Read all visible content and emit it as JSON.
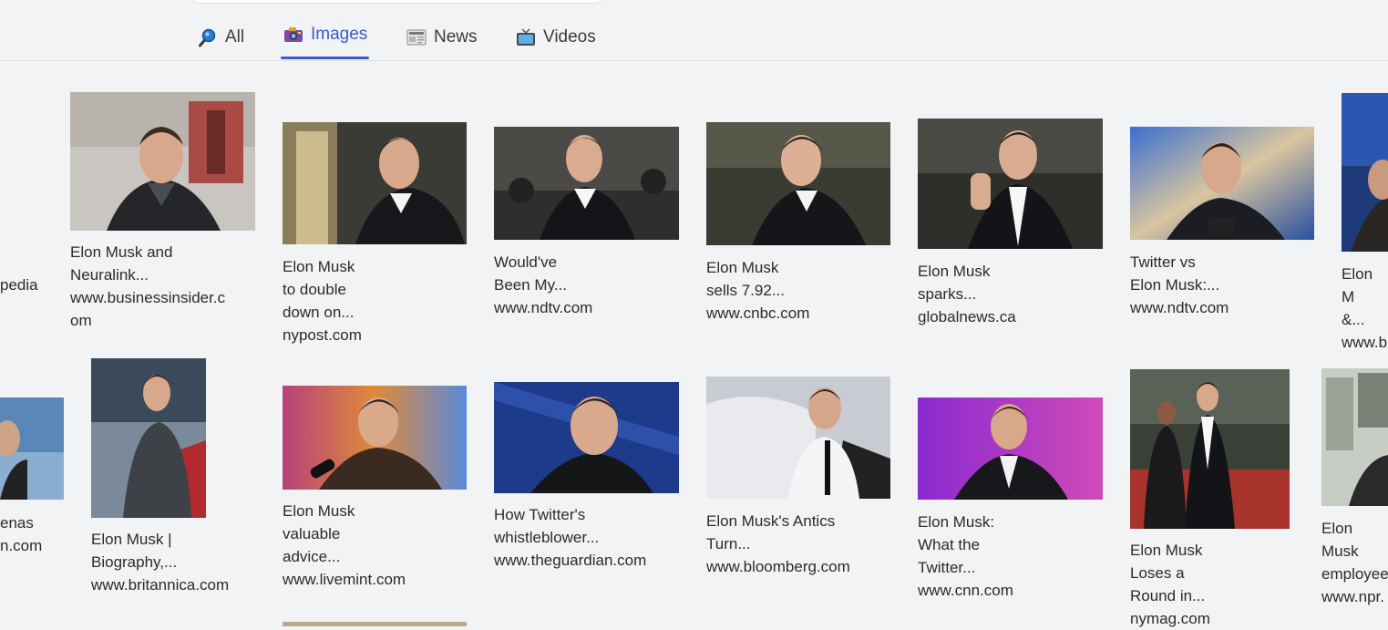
{
  "tabs": [
    {
      "label": "All",
      "icon": "magnifier-icon"
    },
    {
      "label": "Images",
      "icon": "camera-icon",
      "active": true
    },
    {
      "label": "News",
      "icon": "newspaper-icon"
    },
    {
      "label": "Videos",
      "icon": "tv-icon"
    }
  ],
  "colors": {
    "accent": "#3d5bc7",
    "background": "#f2f3f5"
  },
  "results": [
    {
      "lines": [
        "pedia"
      ]
    },
    {
      "lines": [
        "Elon Musk and",
        "Neuralink...",
        "www.businessinsider.c",
        "om"
      ]
    },
    {
      "lines": [
        "Elon Musk to double",
        "down on... nypost.com"
      ]
    },
    {
      "lines": [
        "Would've Been My...",
        "www.ndtv.com"
      ]
    },
    {
      "lines": [
        "Elon Musk sells 7.92...",
        "www.cnbc.com"
      ]
    },
    {
      "lines": [
        "Elon Musk sparks...",
        "globalnews.ca"
      ]
    },
    {
      "lines": [
        "Twitter vs Elon Musk:...",
        "www.ndtv.com"
      ]
    },
    {
      "lines": [
        "Elon M",
        "&...",
        "www.b"
      ]
    },
    {
      "lines": [
        "enas",
        "n.com"
      ]
    },
    {
      "lines": [
        "Elon Musk |",
        "Biography,...",
        "www.britannica.com"
      ]
    },
    {
      "lines": [
        "Elon Musk valuable",
        "advice...",
        "www.livemint.com"
      ]
    },
    {
      "lines": [
        "How Twitter's",
        "whistleblower...",
        "www.theguardian.com"
      ]
    },
    {
      "lines": [
        "Elon Musk's Antics",
        "Turn...",
        "www.bloomberg.com"
      ]
    },
    {
      "lines": [
        "Elon Musk: What the",
        "Twitter... www.cnn.com"
      ]
    },
    {
      "lines": [
        "Elon Musk Loses a",
        "Round in... nymag.com"
      ]
    },
    {
      "lines": [
        "Elon Musk",
        "employee",
        "www.npr."
      ]
    }
  ]
}
